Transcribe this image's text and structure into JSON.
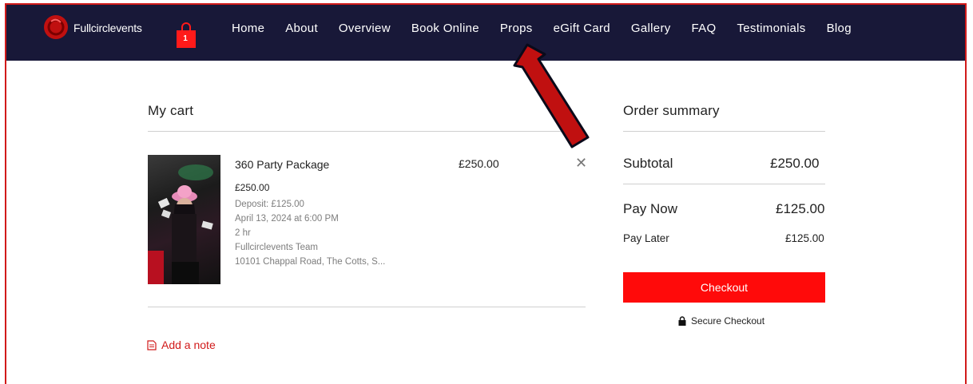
{
  "header": {
    "brand": "Fullcirclevents",
    "cart_count": "1",
    "menu": [
      "Home",
      "About",
      "Overview",
      "Book Online",
      "Props",
      "eGift Card",
      "Gallery",
      "FAQ",
      "Testimonials",
      "Blog"
    ]
  },
  "cart": {
    "title": "My cart",
    "item": {
      "name": "360 Party Package",
      "price": "£250.00",
      "deposit": "Deposit: £125.00",
      "date": "April 13, 2024 at 6:00 PM",
      "duration": "2 hr",
      "staff": "Fullcirclevents Team",
      "address": "10101 Chappal Road, The Cotts, S...",
      "line_total": "£250.00",
      "remove": "✕"
    },
    "add_note": "Add a note"
  },
  "summary": {
    "title": "Order summary",
    "subtotal_label": "Subtotal",
    "subtotal": "£250.00",
    "pay_now_label": "Pay Now",
    "pay_now": "£125.00",
    "pay_later_label": "Pay Later",
    "pay_later": "£125.00",
    "checkout": "Checkout",
    "secure": "Secure Checkout"
  },
  "colors": {
    "nav_bg": "#181838",
    "accent": "#ff0a0a",
    "annotation_arrow": "#c01010"
  },
  "icons": [
    "logo-icon",
    "shopping-bag-icon",
    "close-icon",
    "note-icon",
    "lock-icon",
    "annotation-arrow"
  ]
}
